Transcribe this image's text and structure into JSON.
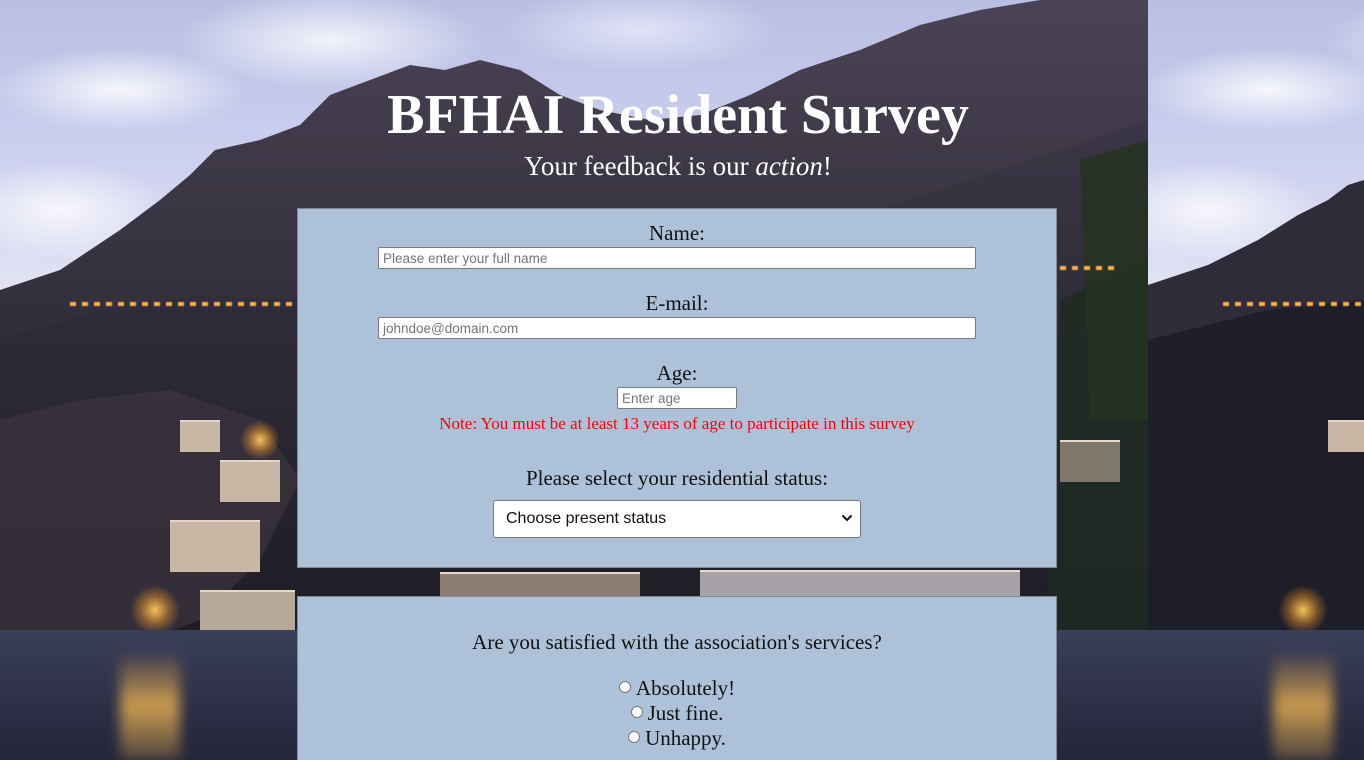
{
  "header": {
    "title": "BFHAI Resident Survey",
    "subtitle_prefix": "Your feedback is our ",
    "subtitle_emphasis": "action",
    "subtitle_suffix": "!"
  },
  "form": {
    "name": {
      "label": "Name:",
      "placeholder": "Please enter your full name",
      "value": ""
    },
    "email": {
      "label": "E-mail:",
      "placeholder": "johndoe@domain.com",
      "value": ""
    },
    "age": {
      "label": "Age:",
      "placeholder": "Enter age",
      "value": "",
      "note": "Note: You must be at least 13 years of age to participate in this survey"
    },
    "status": {
      "label": "Please select your residential status:",
      "selected": "Choose present status"
    }
  },
  "satisfaction": {
    "question": "Are you satisfied with the association's services?",
    "options": [
      {
        "label": "Absolutely!",
        "checked": false
      },
      {
        "label": "Just fine.",
        "checked": false
      },
      {
        "label": "Unhappy.",
        "checked": false
      }
    ]
  },
  "colors": {
    "panel_bg": "#adc2d9",
    "note_text": "#ff0000",
    "header_text": "#ffffff"
  },
  "icons": {
    "select_arrow": "chevron-down-icon"
  }
}
